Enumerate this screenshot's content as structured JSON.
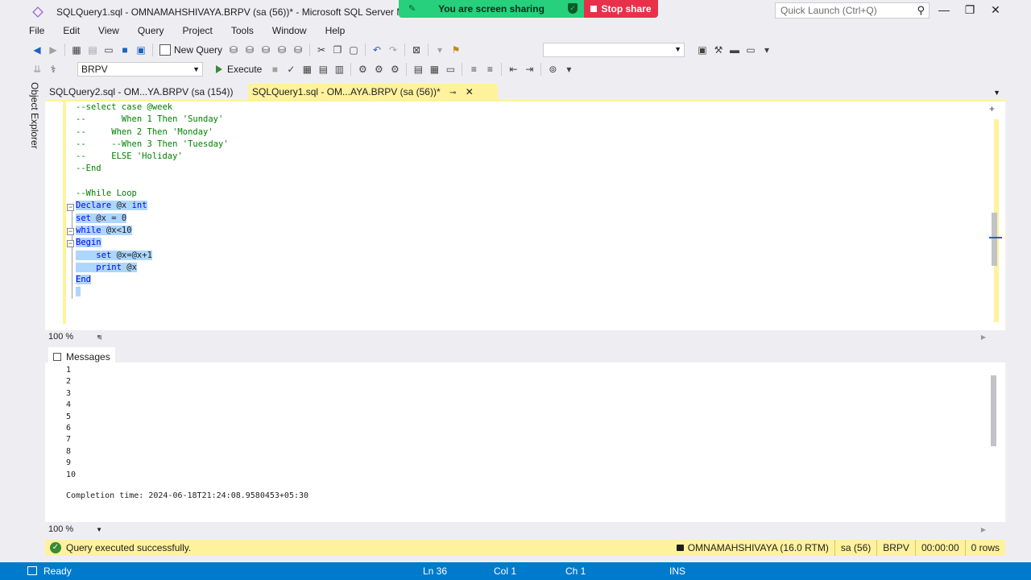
{
  "window": {
    "title": "SQLQuery1.sql - OMNAMAHSHIVAYA.BRPV (sa (56))* - Microsoft SQL Server Manag",
    "quick_launch_placeholder": "Quick Launch (Ctrl+Q)"
  },
  "share": {
    "banner": "You are screen sharing",
    "stop": "Stop share"
  },
  "menu": [
    "File",
    "Edit",
    "View",
    "Query",
    "Project",
    "Tools",
    "Window",
    "Help"
  ],
  "toolbar": {
    "new_query": "New Query",
    "database": "BRPV",
    "execute": "Execute"
  },
  "object_explorer": "Object Explorer",
  "tabs": [
    {
      "label": "SQLQuery2.sql - OM...YA.BRPV (sa (154))",
      "active": false
    },
    {
      "label": "SQLQuery1.sql - OM...AYA.BRPV (sa (56))*",
      "active": true
    }
  ],
  "editor": {
    "lines": [
      {
        "text": "--select case @week",
        "type": "comment"
      },
      {
        "text": "--       When 1 Then 'Sunday'",
        "type": "comment"
      },
      {
        "text": "--     When 2 Then 'Monday'",
        "type": "comment"
      },
      {
        "text": "--     --When 3 Then 'Tuesday'",
        "type": "comment"
      },
      {
        "text": "--     ELSE 'Holiday'",
        "type": "comment"
      },
      {
        "text": "--End",
        "type": "comment"
      },
      {
        "text": "",
        "type": "blank"
      },
      {
        "text": "--While Loop",
        "type": "comment"
      },
      {
        "text": "Declare @x int",
        "type": "selected"
      },
      {
        "text": "set @x = 0",
        "type": "selected"
      },
      {
        "text": "while @x<10",
        "type": "selected"
      },
      {
        "text": "Begin",
        "type": "selected"
      },
      {
        "text": "    set @x=@x+1",
        "type": "selected"
      },
      {
        "text": "    print @x",
        "type": "selected"
      },
      {
        "text": "End",
        "type": "selected"
      },
      {
        "text": " ",
        "type": "selected"
      }
    ],
    "zoom": "100 %"
  },
  "results": {
    "tab_label": "Messages",
    "lines": [
      "1",
      "2",
      "3",
      "4",
      "5",
      "6",
      "7",
      "8",
      "9",
      "10"
    ],
    "completion": "Completion time: 2024-06-18T21:24:08.9580453+05:30",
    "zoom": "100 %"
  },
  "query_status": {
    "message": "Query executed successfully.",
    "server": "OMNAMAHSHIVAYA (16.0 RTM)",
    "user": "sa (56)",
    "database": "BRPV",
    "elapsed": "00:00:00",
    "rows": "0 rows"
  },
  "statusbar": {
    "state": "Ready",
    "ln": "Ln 36",
    "col": "Col 1",
    "ch": "Ch 1",
    "mode": "INS"
  },
  "colors": {
    "status_blue": "#007acc",
    "tab_yellow": "#fff29d",
    "comment_green": "#008000",
    "keyword_blue": "#0000ff",
    "selection": "#add6ff"
  }
}
